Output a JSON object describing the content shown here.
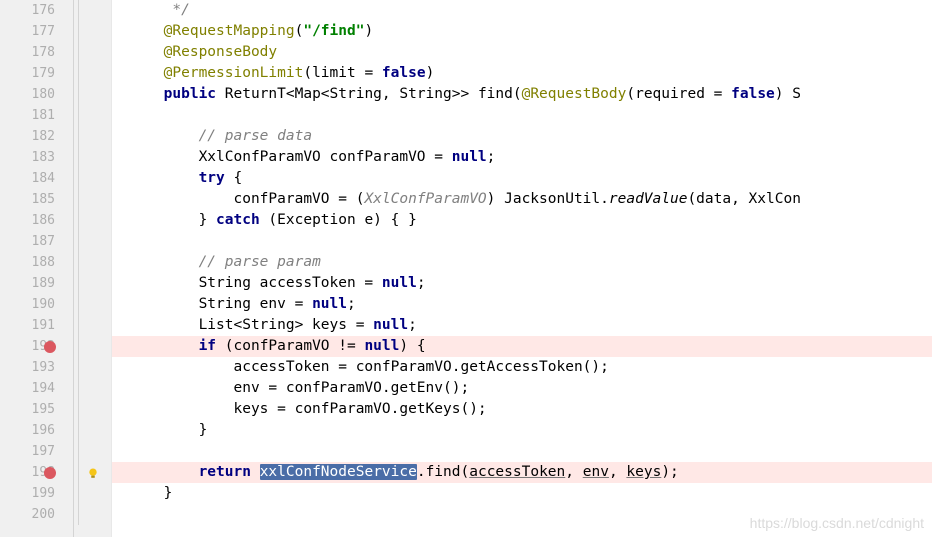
{
  "watermark": "https://blog.csdn.net/cdnight",
  "lines": [
    {
      "num": "176",
      "text": "      */",
      "bp": false,
      "bulb": false,
      "tokens": [
        {
          "t": "      ",
          "c": ""
        },
        {
          "t": "*/",
          "c": "cmt"
        }
      ]
    },
    {
      "num": "177",
      "text": "     @RequestMapping(\"/find\")",
      "bp": false,
      "bulb": false,
      "tokens": [
        {
          "t": "     ",
          "c": ""
        },
        {
          "t": "@RequestMapping",
          "c": "ann"
        },
        {
          "t": "(",
          "c": ""
        },
        {
          "t": "\"/find\"",
          "c": "str"
        },
        {
          "t": ")",
          "c": ""
        }
      ]
    },
    {
      "num": "178",
      "text": "     @ResponseBody",
      "bp": false,
      "bulb": false,
      "tokens": [
        {
          "t": "     ",
          "c": ""
        },
        {
          "t": "@ResponseBody",
          "c": "ann"
        }
      ]
    },
    {
      "num": "179",
      "text": "     @PermessionLimit(limit = false)",
      "bp": false,
      "bulb": false,
      "tokens": [
        {
          "t": "     ",
          "c": ""
        },
        {
          "t": "@PermessionLimit",
          "c": "ann"
        },
        {
          "t": "(limit = ",
          "c": ""
        },
        {
          "t": "false",
          "c": "kw"
        },
        {
          "t": ")",
          "c": ""
        }
      ]
    },
    {
      "num": "180",
      "text": "     public ReturnT<Map<String, String>> find(@RequestBody(required = false) S",
      "bp": false,
      "bulb": false,
      "tokens": [
        {
          "t": "     ",
          "c": ""
        },
        {
          "t": "public",
          "c": "kw"
        },
        {
          "t": " ReturnT<Map<String, String>> find(",
          "c": ""
        },
        {
          "t": "@RequestBody",
          "c": "ann"
        },
        {
          "t": "(required = ",
          "c": ""
        },
        {
          "t": "false",
          "c": "kw"
        },
        {
          "t": ") S",
          "c": ""
        }
      ]
    },
    {
      "num": "181",
      "text": "",
      "bp": false,
      "bulb": false,
      "tokens": []
    },
    {
      "num": "182",
      "text": "         // parse data",
      "bp": false,
      "bulb": false,
      "tokens": [
        {
          "t": "         ",
          "c": ""
        },
        {
          "t": "// parse data",
          "c": "cmt"
        }
      ]
    },
    {
      "num": "183",
      "text": "         XxlConfParamVO confParamVO = null;",
      "bp": false,
      "bulb": false,
      "tokens": [
        {
          "t": "         XxlConfParamVO confParamVO = ",
          "c": ""
        },
        {
          "t": "null",
          "c": "kw"
        },
        {
          "t": ";",
          "c": ""
        }
      ]
    },
    {
      "num": "184",
      "text": "         try {",
      "bp": false,
      "bulb": false,
      "tokens": [
        {
          "t": "         ",
          "c": ""
        },
        {
          "t": "try",
          "c": "kw"
        },
        {
          "t": " {",
          "c": ""
        }
      ]
    },
    {
      "num": "185",
      "text": "             confParamVO = (XxlConfParamVO) JacksonUtil.readValue(data, XxlCon",
      "bp": false,
      "bulb": false,
      "tokens": [
        {
          "t": "             confParamVO = (",
          "c": ""
        },
        {
          "t": "XxlConfParamVO",
          "c": "cmt"
        },
        {
          "t": ") JacksonUtil.",
          "c": ""
        },
        {
          "t": "readValue",
          "c": "mtd-static"
        },
        {
          "t": "(data, XxlCon",
          "c": ""
        }
      ]
    },
    {
      "num": "186",
      "text": "         } catch (Exception e) { }",
      "bp": false,
      "bulb": false,
      "tokens": [
        {
          "t": "         } ",
          "c": ""
        },
        {
          "t": "catch",
          "c": "kw"
        },
        {
          "t": " (Exception e) { }",
          "c": ""
        }
      ]
    },
    {
      "num": "187",
      "text": "",
      "bp": false,
      "bulb": false,
      "tokens": []
    },
    {
      "num": "188",
      "text": "         // parse param",
      "bp": false,
      "bulb": false,
      "tokens": [
        {
          "t": "         ",
          "c": ""
        },
        {
          "t": "// parse param",
          "c": "cmt"
        }
      ]
    },
    {
      "num": "189",
      "text": "         String accessToken = null;",
      "bp": false,
      "bulb": false,
      "tokens": [
        {
          "t": "         String accessToken = ",
          "c": ""
        },
        {
          "t": "null",
          "c": "kw"
        },
        {
          "t": ";",
          "c": ""
        }
      ]
    },
    {
      "num": "190",
      "text": "         String env = null;",
      "bp": false,
      "bulb": false,
      "tokens": [
        {
          "t": "         String env = ",
          "c": ""
        },
        {
          "t": "null",
          "c": "kw"
        },
        {
          "t": ";",
          "c": ""
        }
      ]
    },
    {
      "num": "191",
      "text": "         List<String> keys = null;",
      "bp": false,
      "bulb": false,
      "tokens": [
        {
          "t": "         List<String> keys = ",
          "c": ""
        },
        {
          "t": "null",
          "c": "kw"
        },
        {
          "t": ";",
          "c": ""
        }
      ]
    },
    {
      "num": "192",
      "text": "         if (confParamVO != null) {",
      "bp": true,
      "bulb": false,
      "tokens": [
        {
          "t": "         ",
          "c": ""
        },
        {
          "t": "if",
          "c": "kw"
        },
        {
          "t": " (confParamVO != ",
          "c": ""
        },
        {
          "t": "null",
          "c": "kw"
        },
        {
          "t": ") {",
          "c": ""
        }
      ]
    },
    {
      "num": "193",
      "text": "             accessToken = confParamVO.getAccessToken();",
      "bp": false,
      "bulb": false,
      "tokens": [
        {
          "t": "             accessToken = confParamVO.getAccessToken();",
          "c": ""
        }
      ]
    },
    {
      "num": "194",
      "text": "             env = confParamVO.getEnv();",
      "bp": false,
      "bulb": false,
      "tokens": [
        {
          "t": "             env = confParamVO.getEnv();",
          "c": ""
        }
      ]
    },
    {
      "num": "195",
      "text": "             keys = confParamVO.getKeys();",
      "bp": false,
      "bulb": false,
      "tokens": [
        {
          "t": "             keys = confParamVO.getKeys();",
          "c": ""
        }
      ]
    },
    {
      "num": "196",
      "text": "         }",
      "bp": false,
      "bulb": false,
      "tokens": [
        {
          "t": "         }",
          "c": ""
        }
      ]
    },
    {
      "num": "197",
      "text": "",
      "bp": false,
      "bulb": false,
      "tokens": []
    },
    {
      "num": "198",
      "text": "         return xxlConfNodeService.find(accessToken, env, keys);",
      "bp": true,
      "bulb": true,
      "tokens": [
        {
          "t": "         ",
          "c": ""
        },
        {
          "t": "return",
          "c": "kw"
        },
        {
          "t": " ",
          "c": ""
        },
        {
          "t": "xxlConfNodeService",
          "c": "highlight-sel"
        },
        {
          "t": ".find(",
          "c": ""
        },
        {
          "t": "accessToken",
          "c": "param"
        },
        {
          "t": ", ",
          "c": ""
        },
        {
          "t": "env",
          "c": "param"
        },
        {
          "t": ", ",
          "c": ""
        },
        {
          "t": "keys",
          "c": "param"
        },
        {
          "t": ");",
          "c": ""
        }
      ]
    },
    {
      "num": "199",
      "text": "     }",
      "bp": false,
      "bulb": false,
      "tokens": [
        {
          "t": "     }",
          "c": ""
        }
      ]
    },
    {
      "num": "200",
      "text": "",
      "bp": false,
      "bulb": false,
      "tokens": []
    }
  ]
}
